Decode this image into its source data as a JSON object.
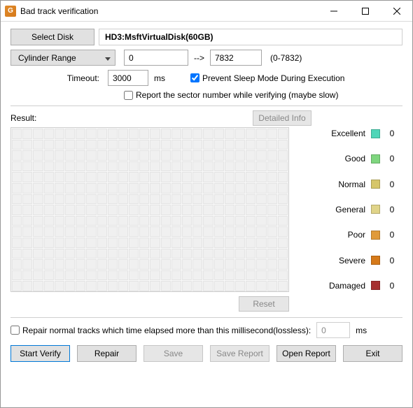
{
  "window": {
    "title": "Bad track verification"
  },
  "toolbar": {
    "select_disk": "Select Disk",
    "disk_name": "HD3:MsftVirtualDisk(60GB)"
  },
  "cylinder": {
    "label": "Cylinder Range",
    "from": "0",
    "to": "7832",
    "hint": "(0-7832)"
  },
  "timeout": {
    "label": "Timeout:",
    "value": "3000",
    "unit": "ms"
  },
  "options": {
    "prevent_sleep": {
      "label": "Prevent Sleep Mode During Execution",
      "checked": true
    },
    "report_sector": {
      "label": "Report the sector number while verifying (maybe slow)",
      "checked": false
    },
    "repair_normal": {
      "label": "Repair normal tracks which time elapsed more than this millisecond(lossless):",
      "checked": false,
      "value": "0",
      "unit": "ms"
    }
  },
  "result": {
    "label": "Result:",
    "detailed_info": "Detailed Info",
    "reset": "Reset"
  },
  "legend": {
    "excellent": {
      "label": "Excellent",
      "count": "0"
    },
    "good": {
      "label": "Good",
      "count": "0"
    },
    "normal": {
      "label": "Normal",
      "count": "0"
    },
    "general": {
      "label": "General",
      "count": "0"
    },
    "poor": {
      "label": "Poor",
      "count": "0"
    },
    "severe": {
      "label": "Severe",
      "count": "0"
    },
    "damaged": {
      "label": "Damaged",
      "count": "0"
    }
  },
  "buttons": {
    "start_verify": "Start Verify",
    "repair": "Repair",
    "save": "Save",
    "save_report": "Save Report",
    "open_report": "Open Report",
    "exit": "Exit"
  }
}
